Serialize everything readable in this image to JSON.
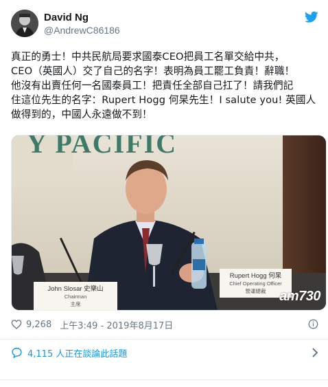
{
  "user": {
    "display_name": "David Ng",
    "handle": "@AndrewC86186",
    "avatar_icon": "profile-photo"
  },
  "tweet": {
    "text": "真正的勇士！中共民航局要求國泰CEO把員工名單交給中共，\nCEO（英國人）交了自己的名字！表明為員工罷工負責！辭職！\n他沒有出賣任何一名國泰員工！把責任全部自己扛了！請我們記\n住這位先生的名字：Rupert Hogg 何杲先生！I salute you! 英國人\n做得到的，中國人永遠做不到！"
  },
  "media": {
    "background_sign": "Y PACIFIC",
    "placard_left_name": "John Slosar 史樂山",
    "placard_left_title": "Chairman",
    "placard_left_title2": "主席",
    "placard_right_name": "Rupert Hogg 何杲",
    "placard_right_title": "Chief Operating Officer",
    "placard_right_title2": "營運總裁",
    "watermark": "am730"
  },
  "meta": {
    "likes": "9,268",
    "timestamp": "上午3:49 - 2019年8月17日"
  },
  "conversation": {
    "label": "4,115 人正在談論此話題"
  },
  "colors": {
    "twitter_blue": "#1da1f2",
    "link_blue": "#1b95e0",
    "muted": "#657786",
    "text": "#14171a",
    "heart": "#657786"
  }
}
